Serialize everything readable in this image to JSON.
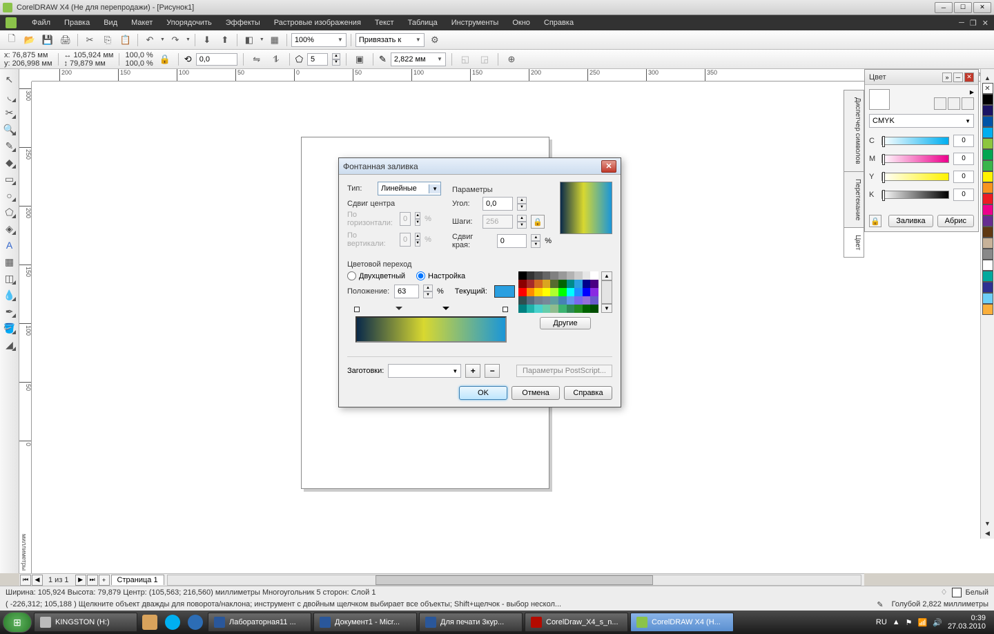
{
  "window": {
    "title": "CorelDRAW X4 (Не для перепродажи) - [Рисунок1]"
  },
  "menu": {
    "items": [
      "Файл",
      "Правка",
      "Вид",
      "Макет",
      "Упорядочить",
      "Эффекты",
      "Растровые изображения",
      "Текст",
      "Таблица",
      "Инструменты",
      "Окно",
      "Справка"
    ]
  },
  "toolbar": {
    "zoom": "100%",
    "snap_label": "Привязать к"
  },
  "propbar": {
    "x": "76,875 мм",
    "y": "206,998 мм",
    "w": "105,924 мм",
    "h": "79,879 мм",
    "sx": "100,0",
    "sy": "100,0",
    "angle": "0,0",
    "sides": "5",
    "outline": "2,822 мм"
  },
  "ruler_unit": "миллиметры",
  "pagenav": {
    "info": "1 из 1",
    "tab": "Страница 1"
  },
  "status": {
    "line1_left": "Ширина: 105,924  Высота: 79,879  Центр: (105,563; 216,560)  миллиметры        Многоугольник  5 сторон: Слой 1",
    "line1_fill": "Белый",
    "line1_outline": "Голубой  2,822 миллиметры",
    "line2": "( -226,312; 105,188 )     Щелкните объект дважды для поворота/наклона; инструмент с двойным щелчком выбирает все объекты; Shift+щелчок - выбор нескол..."
  },
  "docker": {
    "title": "Цвет",
    "model": "CMYK",
    "c": "0",
    "m": "0",
    "y": "0",
    "k": "0",
    "fill_btn": "Заливка",
    "outline_btn": "Абрис"
  },
  "vtabs": [
    "Диспетчер символов",
    "Перетекание",
    "Цвет"
  ],
  "palette_colors": [
    "#000000",
    "#1b1464",
    "#0054a6",
    "#00aeef",
    "#8dc63f",
    "#00a651",
    "#39b54a",
    "#fff200",
    "#f7941e",
    "#ed1c24",
    "#ec008c",
    "#662d91",
    "#603913",
    "#c7b299",
    "#898989",
    "#ffffff",
    "#00a99d",
    "#2e3192",
    "#6dcff6",
    "#faaf3b"
  ],
  "dialog": {
    "title": "Фонтанная заливка",
    "type_label": "Тип:",
    "type_value": "Линейные",
    "center_label": "Сдвиг центра",
    "hcenter_label": "По горизонтали:",
    "vcenter_label": "По вертикали:",
    "hcenter": "0",
    "vcenter": "0",
    "params_label": "Параметры",
    "angle_label": "Угол:",
    "angle": "0,0",
    "steps_label": "Шаги:",
    "steps": "256",
    "edge_label": "Сдвиг края:",
    "edge": "0",
    "blend_label": "Цветовой переход",
    "two_label": "Двухцветный",
    "custom_label": "Настройка",
    "pos_label": "Положение:",
    "pos": "63",
    "current_label": "Текущий:",
    "current_color": "#2a9fe0",
    "other_btn": "Другие",
    "presets_label": "Заготовки:",
    "ps_btn": "Параметры PostScript...",
    "ok": "OK",
    "cancel": "Отмена",
    "help": "Справка"
  },
  "picker_colors": [
    [
      "#000000",
      "#333333",
      "#4d4d4d",
      "#666666",
      "#808080",
      "#999999",
      "#b3b3b3",
      "#cccccc",
      "#e6e6e6",
      "#ffffff"
    ],
    [
      "#8b0000",
      "#a52a2a",
      "#d2691e",
      "#daa520",
      "#556b2f",
      "#006400",
      "#008b8b",
      "#2a9fe0",
      "#00008b",
      "#4b0082"
    ],
    [
      "#ff0000",
      "#ff8c00",
      "#ffd700",
      "#ffff00",
      "#adff2f",
      "#00ff00",
      "#00ffff",
      "#1e90ff",
      "#0000ff",
      "#8a2be2"
    ],
    [
      "#2f4f4f",
      "#556b7f",
      "#708090",
      "#778899",
      "#5f9ea0",
      "#4682b4",
      "#6495ed",
      "#7b68ee",
      "#9370db",
      "#6a5acd"
    ],
    [
      "#008080",
      "#20b2aa",
      "#48d1cc",
      "#66cdaa",
      "#8fbc8f",
      "#3cb371",
      "#2e8b57",
      "#228b22",
      "#006400",
      "#004d00"
    ]
  ],
  "taskbar": {
    "items": [
      "KINGSTON (H:)",
      "",
      "",
      "",
      "Лабораторная11 ...",
      "Документ1 - Micr...",
      "Для печати 3кур...",
      "CorelDraw_X4_s_n...",
      "CorelDRAW X4 (Н..."
    ],
    "lang": "RU",
    "time": "0:39",
    "date": "27.03.2010"
  }
}
